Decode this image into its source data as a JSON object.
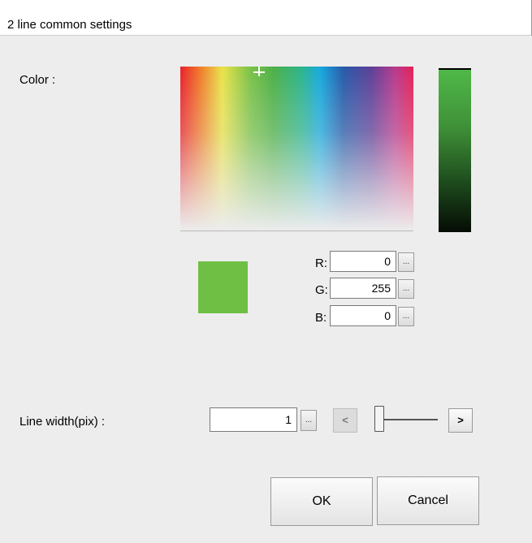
{
  "window": {
    "title": "2 line common settings"
  },
  "color": {
    "label": "Color :",
    "r_label": "R:",
    "r_value": "0",
    "g_label": "G:",
    "g_value": "255",
    "b_label": "B:",
    "b_value": "0",
    "browse_label": "...",
    "selected_hex": "#70bf45"
  },
  "line_width": {
    "label": "Line width(pix) :",
    "value": "1",
    "browse_label": "...",
    "decrease_label": "<",
    "increase_label": ">",
    "slider_level": 1
  },
  "buttons": {
    "ok": "OK",
    "cancel": "Cancel"
  }
}
